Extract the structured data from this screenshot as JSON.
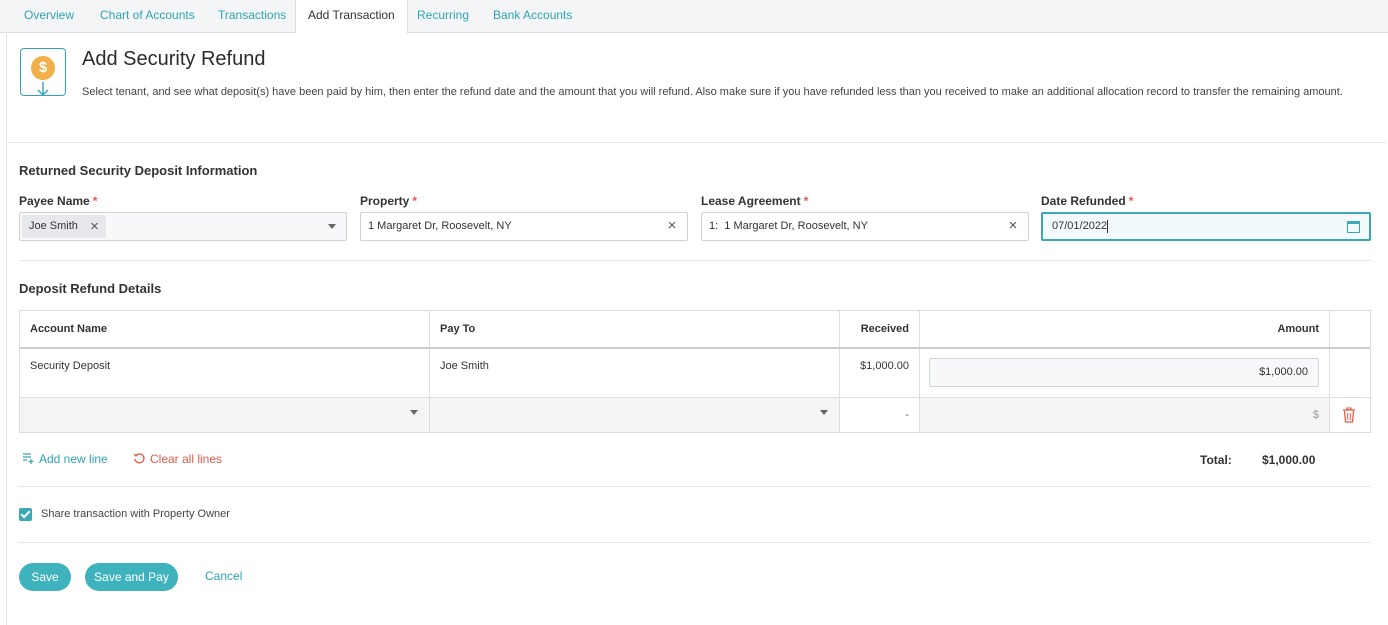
{
  "tabs": [
    {
      "label": "Overview"
    },
    {
      "label": "Chart of Accounts"
    },
    {
      "label": "Transactions"
    },
    {
      "label": "Add Transaction"
    },
    {
      "label": "Recurring"
    },
    {
      "label": "Bank Accounts"
    }
  ],
  "header": {
    "title": "Add Security Refund",
    "description": "Select tenant, and see what deposit(s) have been paid by him, then enter the refund date and the amount that you will refund. Also make sure if you have refunded less than you received to make an additional allocation record to transfer the remaining amount.",
    "icon": "dollar-refund-icon",
    "coin_symbol": "$"
  },
  "deposit_info": {
    "title": "Returned Security Deposit Information",
    "required_mark": "*",
    "payee": {
      "label": "Payee Name",
      "value": "Joe Smith"
    },
    "property": {
      "label": "Property",
      "value": "1 Margaret Dr, Roosevelt, NY"
    },
    "lease": {
      "label": "Lease Agreement",
      "value": "1:  1 Margaret Dr, Roosevelt, NY"
    },
    "date": {
      "label": "Date Refunded",
      "value": "07/01/2022"
    }
  },
  "refund_details": {
    "title": "Deposit Refund Details",
    "columns": {
      "account": "Account Name",
      "pay_to": "Pay To",
      "received": "Received",
      "amount": "Amount"
    },
    "rows": [
      {
        "account": "Security Deposit",
        "pay_to": "Joe Smith",
        "received": "$1,000.00",
        "amount": "$1,000.00"
      }
    ],
    "empty_row": {
      "received": "-",
      "amount_placeholder": "$"
    },
    "add_line": "Add new line",
    "clear_lines": "Clear all lines",
    "total_label": "Total:",
    "total_value": "$1,000.00"
  },
  "share": {
    "label": "Share transaction with Property Owner",
    "checked": true
  },
  "actions": {
    "save": "Save",
    "save_and_pay": "Save and Pay",
    "cancel": "Cancel"
  },
  "colors": {
    "accent": "#3fb3bd",
    "link": "#2fa3b5",
    "danger": "#e05b4b",
    "coin": "#f2b04b"
  }
}
